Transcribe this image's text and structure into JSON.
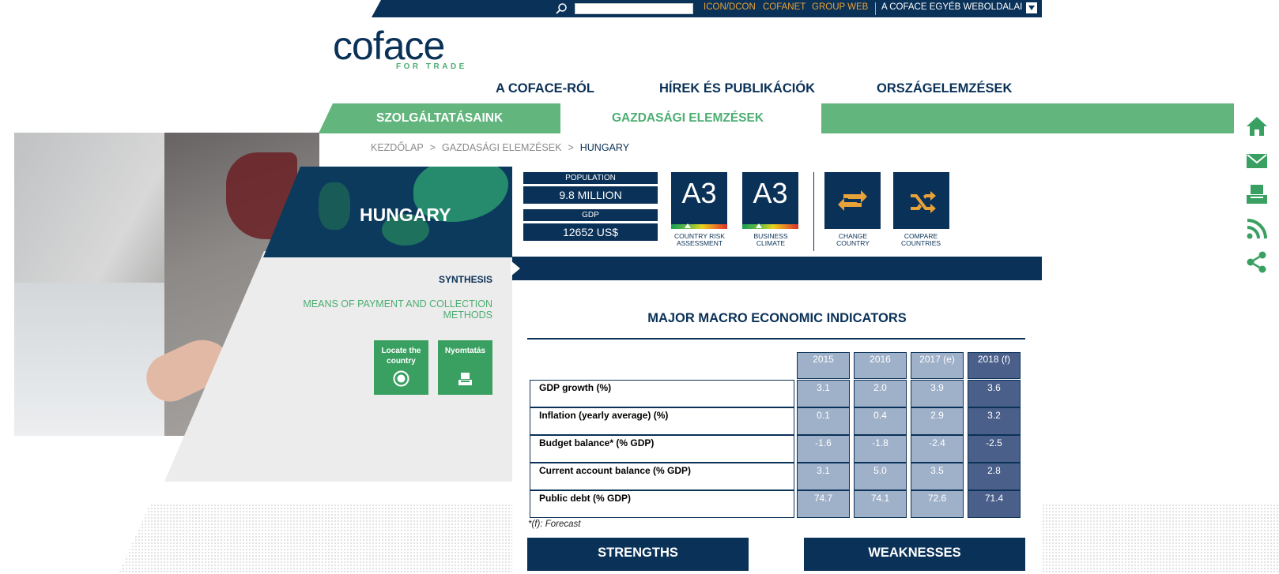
{
  "topbar": {
    "links": [
      "ICON/DCON",
      "COFANET",
      "GROUP WEB"
    ],
    "other_sites": "A COFACE EGYÉB WEBOLDALAI",
    "search_value": ""
  },
  "logo": {
    "word": "coface",
    "tagline": "FOR TRADE"
  },
  "nav": {
    "main": [
      "A COFACE-RÓL",
      "HÍREK ÉS PUBLIKÁCIÓK",
      "ORSZÁGELEMZÉSEK"
    ],
    "sub": [
      "SZOLGÁLTATÁSAINK",
      "GAZDASÁGI ELEMZÉSEK"
    ]
  },
  "breadcrumb": {
    "items": [
      "KEZDŐLAP",
      "GAZDASÁGI ELEMZÉSEK",
      "HUNGARY"
    ],
    "sep": ">"
  },
  "country": {
    "name": "HUNGARY",
    "population_label": "POPULATION",
    "population_value": "9.8 MILLION",
    "gdp_label": "GDP",
    "gdp_value": "12652 US$"
  },
  "ratings": [
    {
      "grade": "A3",
      "caption_line1": "COUNTRY RISK",
      "caption_line2": "ASSESSMENT"
    },
    {
      "grade": "A3",
      "caption_line1": "BUSINESS",
      "caption_line2": "CLIMATE"
    }
  ],
  "actions": [
    {
      "caption_line1": "CHANGE",
      "caption_line2": "COUNTRY",
      "icon": "swap-arrows-icon"
    },
    {
      "caption_line1": "COMPARE",
      "caption_line2": "COUNTRIES",
      "icon": "shuffle-icon"
    }
  ],
  "sidebar": {
    "synthesis": "SYNTHESIS",
    "means": "MEANS OF PAYMENT AND COLLECTION METHODS",
    "locate_line1": "Locate the",
    "locate_line2": "country",
    "print": "Nyomtatás"
  },
  "macro": {
    "title": "MAJOR MACRO ECONOMIC INDICATORS",
    "years": [
      "2015",
      "2016",
      "2017 (e)",
      "2018 (f)"
    ],
    "rows": [
      {
        "label": "GDP growth (%)",
        "values": [
          "3.1",
          "2.0",
          "3.9",
          "3.6"
        ]
      },
      {
        "label": "Inflation (yearly average) (%)",
        "values": [
          "0.1",
          "0.4",
          "2.9",
          "3.2"
        ]
      },
      {
        "label": "Budget balance* (% GDP)",
        "values": [
          "-1.6",
          "-1.8",
          "-2.4",
          "-2.5"
        ]
      },
      {
        "label": "Current account balance (% GDP)",
        "values": [
          "3.1",
          "5.0",
          "3.5",
          "2.8"
        ]
      },
      {
        "label": "Public debt (% GDP)",
        "values": [
          "74.7",
          "74.1",
          "72.6",
          "71.4"
        ]
      }
    ],
    "footnote": "*(f): Forecast"
  },
  "sections": {
    "strengths": "STRENGTHS",
    "weaknesses": "WEAKNESSES"
  },
  "colors": {
    "navy": "#0a3157",
    "green": "#62b57c",
    "dark_green": "#3aa062",
    "orange": "#e8a23a",
    "cell_light": "#9fb0c9",
    "cell_dark": "#4a5f8a"
  },
  "rail_icons": [
    "home-icon",
    "mail-icon",
    "print-icon",
    "rss-icon",
    "share-icon"
  ]
}
